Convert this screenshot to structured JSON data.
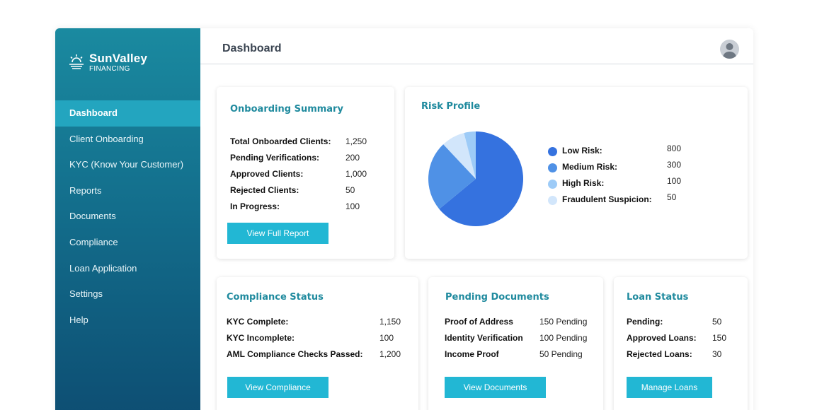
{
  "brand": {
    "name": "SunValley",
    "subtitle": "FINANCING"
  },
  "sidebar": {
    "items": [
      {
        "label": "Dashboard",
        "active": true
      },
      {
        "label": "Client Onboarding"
      },
      {
        "label": "KYC (Know Your Customer)"
      },
      {
        "label": "Reports"
      },
      {
        "label": "Documents"
      },
      {
        "label": "Compliance"
      },
      {
        "label": "Loan Application"
      },
      {
        "label": "Settings"
      },
      {
        "label": "Help"
      }
    ]
  },
  "header": {
    "title": "Dashboard",
    "avatar_icon": "user-avatar-icon"
  },
  "onboarding": {
    "title": "Onboarding Summary",
    "rows": [
      {
        "label": "Total Onboarded Clients:",
        "value": "1,250"
      },
      {
        "label": "Pending Verifications:",
        "value": "200"
      },
      {
        "label": "Approved Clients:",
        "value": "1,000"
      },
      {
        "label": "Rejected Clients:",
        "value": "50"
      },
      {
        "label": "In Progress:",
        "value": "100"
      }
    ],
    "button": "View Full Report"
  },
  "risk": {
    "title": "Risk Profile",
    "legend": [
      {
        "label": "Low Risk:",
        "value": "800",
        "color": "#3572df"
      },
      {
        "label": "Medium Risk:",
        "value": "300",
        "color": "#4f91e6"
      },
      {
        "label": "High Risk:",
        "value": "100",
        "color": "#9dcbf7"
      },
      {
        "label": "Fraudulent Suspicion:",
        "value": "50",
        "color": "#d2e6fb"
      }
    ]
  },
  "chart_data": {
    "type": "pie",
    "categories": [
      "Low Risk",
      "Medium Risk",
      "High Risk",
      "Fraudulent Suspicion"
    ],
    "values": [
      800,
      300,
      100,
      50
    ],
    "colors": [
      "#3572df",
      "#4f91e6",
      "#d2e6fb",
      "#9dcbf7"
    ],
    "title": "Risk Profile",
    "legend": "right"
  },
  "compliance": {
    "title": "Compliance Status",
    "rows": [
      {
        "label": "KYC Complete:",
        "value": "1,150"
      },
      {
        "label": "KYC Incomplete:",
        "value": "100"
      },
      {
        "label": "AML Compliance Checks Passed:",
        "value": "1,200"
      }
    ],
    "button": "View Compliance"
  },
  "documents": {
    "title": "Pending Documents",
    "rows": [
      {
        "label": "Proof of Address",
        "value": "150 Pending"
      },
      {
        "label": "Identity Verification",
        "value": "100 Pending"
      },
      {
        "label": "Income Proof",
        "value": "50 Pending"
      }
    ],
    "button": "View Documents"
  },
  "loans": {
    "title": "Loan Status",
    "rows": [
      {
        "label": "Pending:",
        "value": "50"
      },
      {
        "label": "Approved Loans:",
        "value": "150"
      },
      {
        "label": "Rejected Loans:",
        "value": "30"
      }
    ],
    "button": "Manage Loans"
  }
}
